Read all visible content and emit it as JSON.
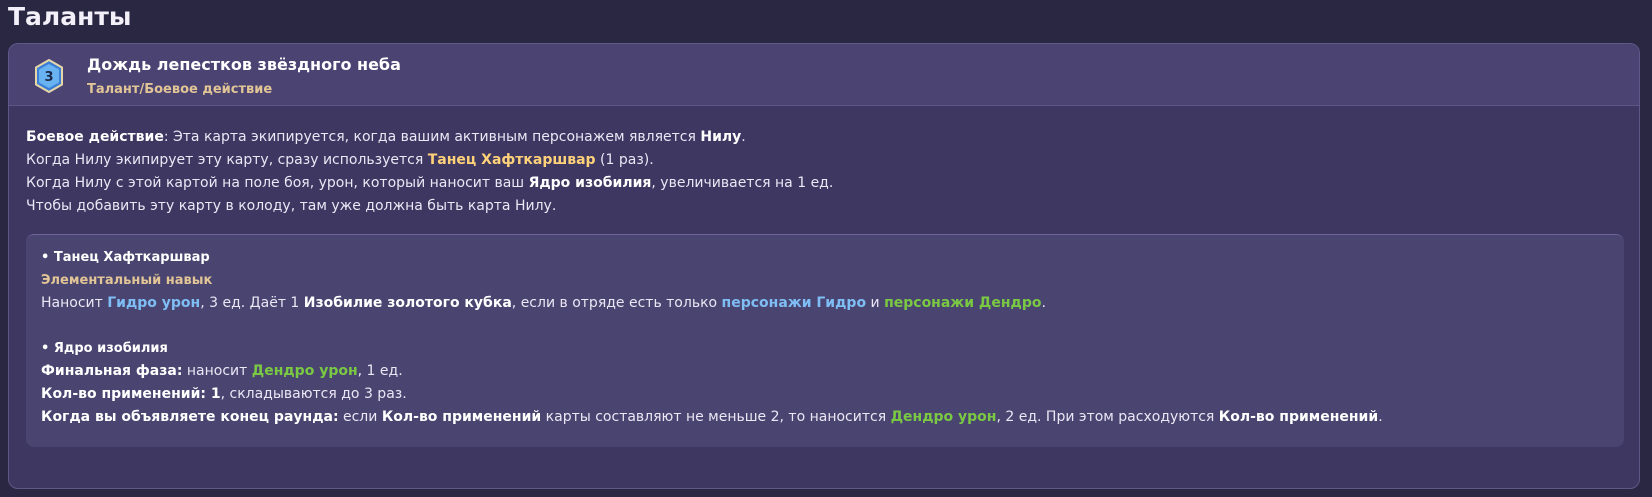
{
  "section_title": "Таланты",
  "card": {
    "cost": "3",
    "cost_icon": "hydro-dice-icon",
    "name": "Дождь лепестков звёздного неба",
    "type": "Талант/Боевое действие"
  },
  "description": {
    "l1": {
      "a": "Боевое действие",
      "b": ": Эта карта экипируется, когда вашим активным персонажем является ",
      "c": "Нилу",
      "d": "."
    },
    "l2": {
      "a": "Когда Нилу экипирует эту карту, сразу используется ",
      "b": "Танец Хафткаршвар",
      "c": " (1 раз)."
    },
    "l3": {
      "a": "Когда Нилу с этой картой на поле боя, урон, который наносит ваш ",
      "b": "Ядро изобилия",
      "c": ", увеличивается на 1 ед."
    },
    "l4": "Чтобы добавить эту карту в колоду, там уже должна быть карта Нилу."
  },
  "skill": {
    "title": "• Танец Хафткаршвар",
    "type": "Элементальный навык",
    "line": {
      "a": "Наносит ",
      "b": "Гидро урон",
      "c": ", 3 ед. Даёт 1 ",
      "d": "Изобилие золотого кубка",
      "e": ", если в отряде есть только ",
      "f": "персонажи Гидро",
      "g": " и ",
      "h": "персонажи Дендро",
      "i": "."
    }
  },
  "core": {
    "title": "• Ядро изобилия",
    "l1": {
      "a": "Финальная фаза:",
      "b": " наносит ",
      "c": "Дендро урон",
      "d": ", 1 ед."
    },
    "l2": {
      "a": "Кол-во применений: 1",
      "b": ", складываются до 3 раз."
    },
    "l3": {
      "a": "Когда вы объявляете конец раунда:",
      "b": " если ",
      "c": "Кол-во применений",
      "d": " карты составляют не меньше 2, то наносится ",
      "e": "Дендро урон",
      "f": ", 2 ед. При этом расходуются ",
      "g": "Кол-во применений",
      "h": "."
    }
  }
}
